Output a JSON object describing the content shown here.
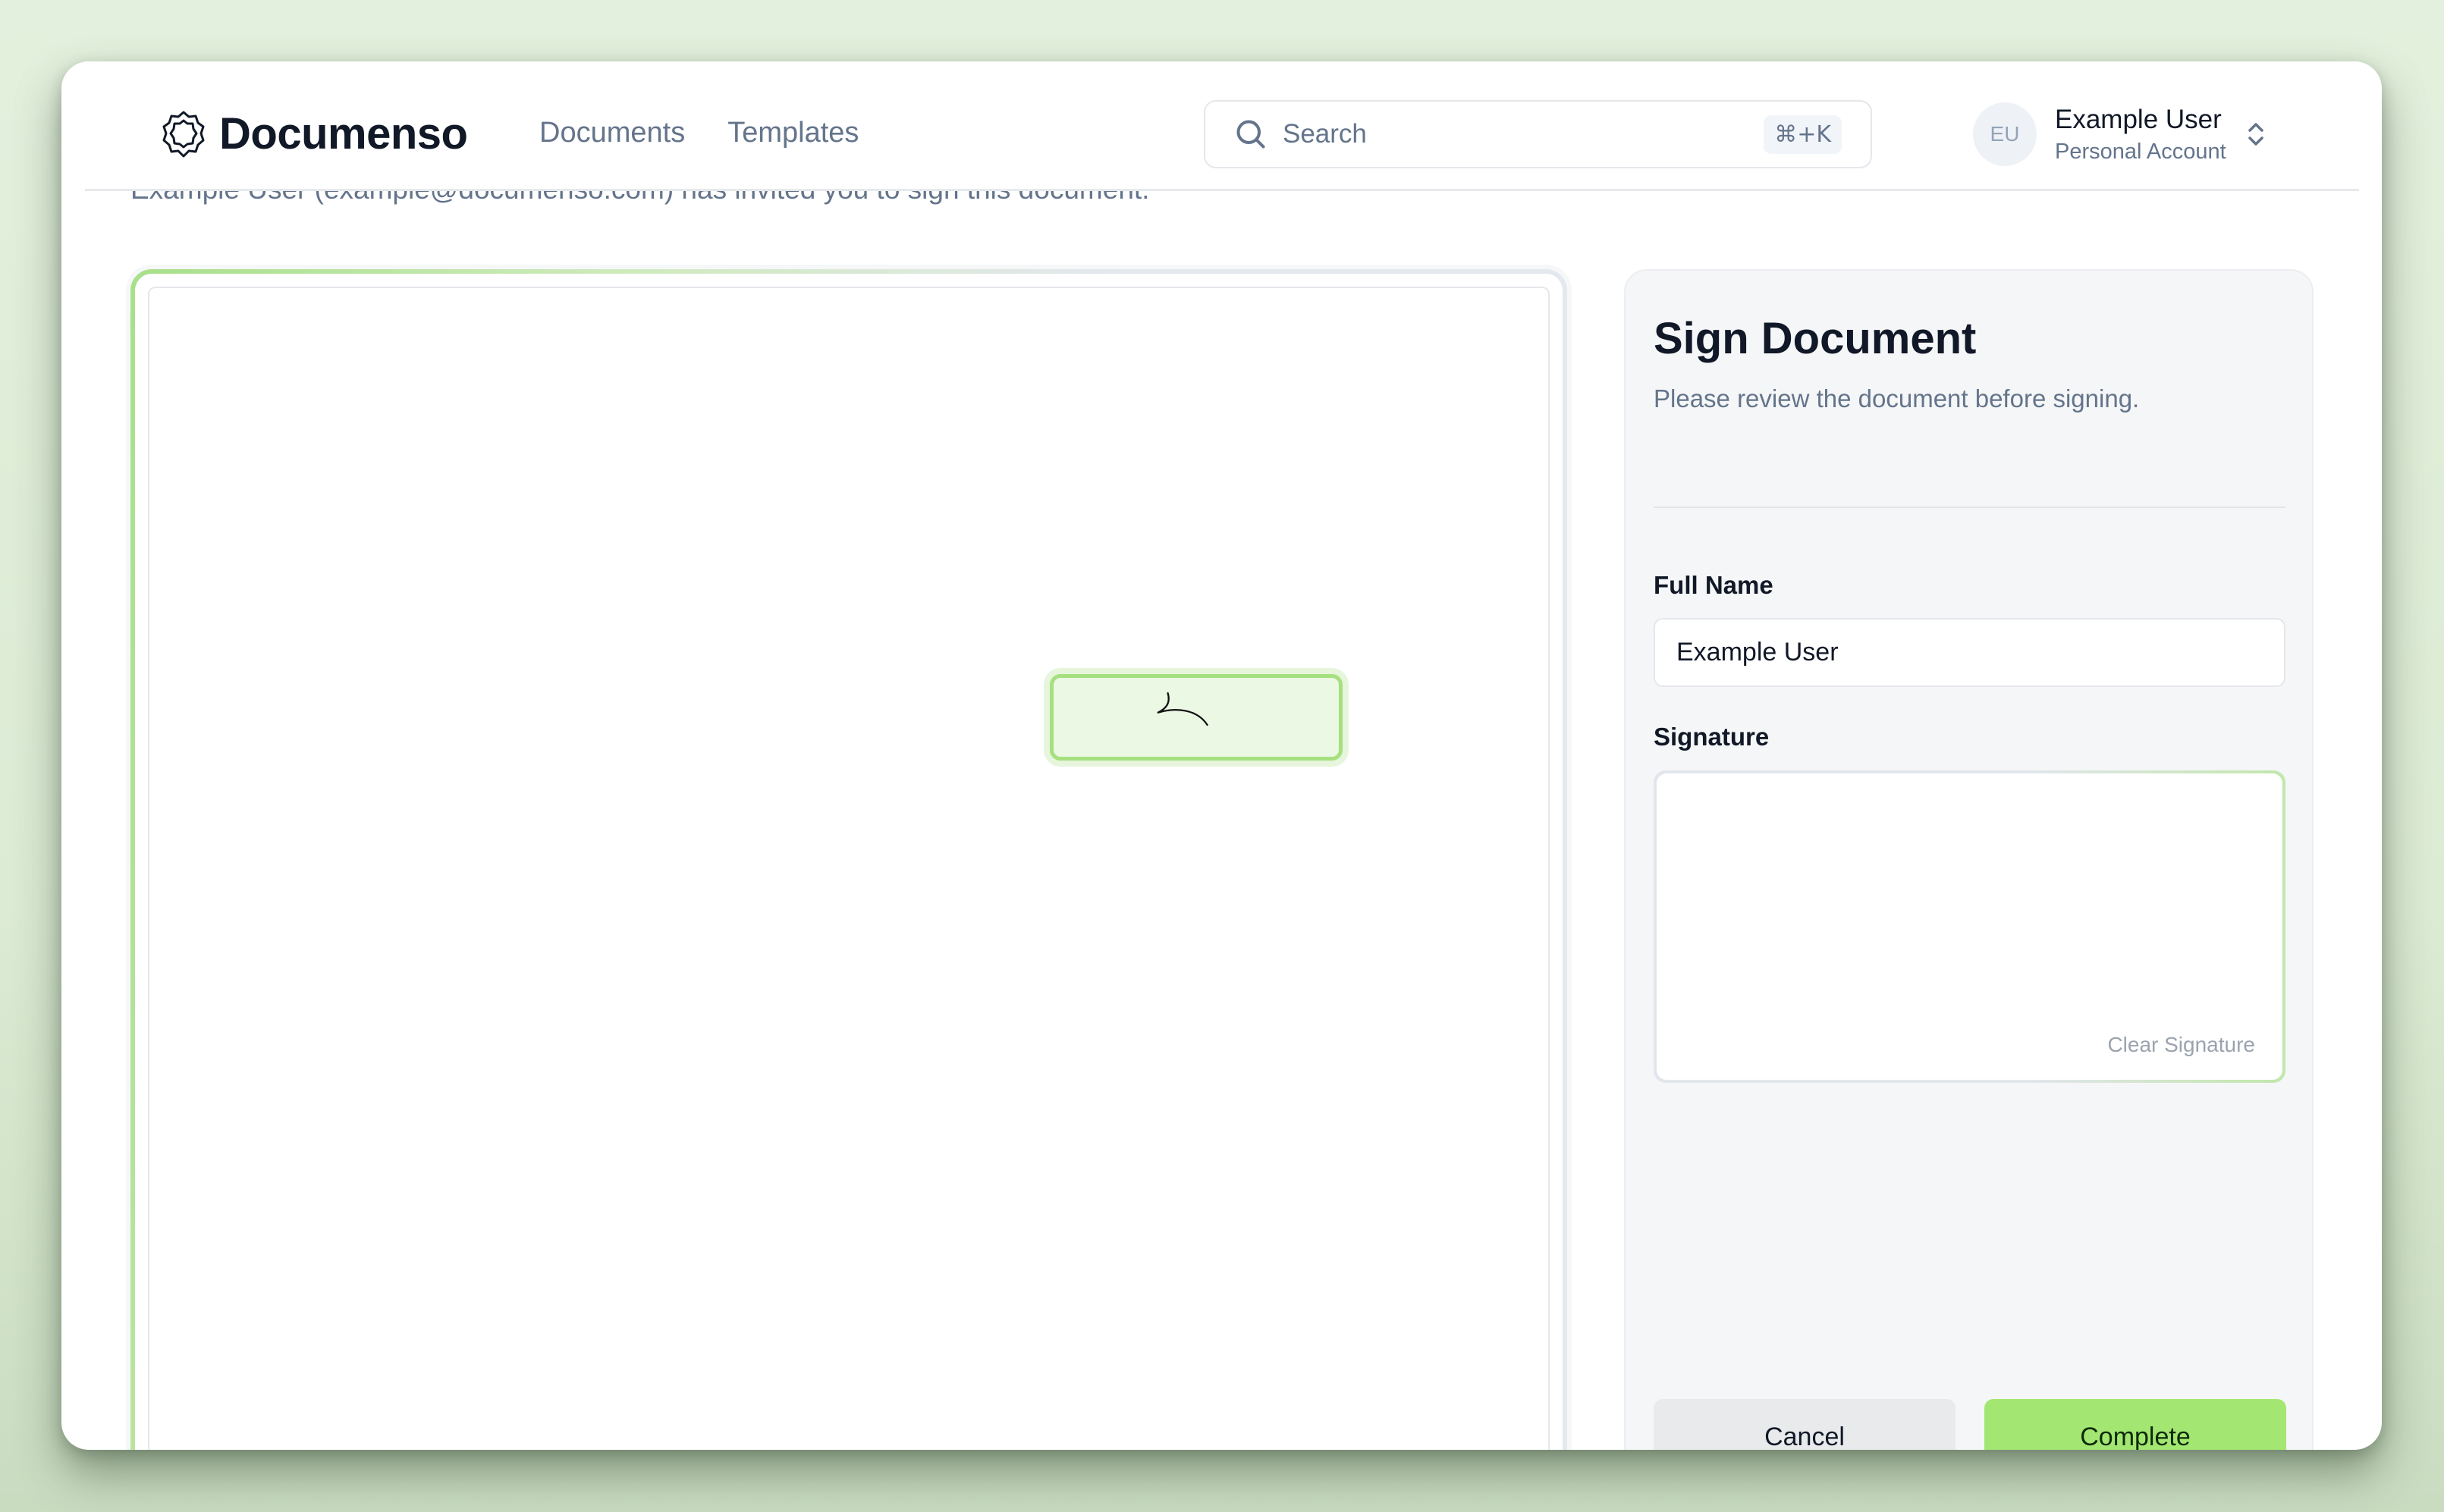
{
  "app": {
    "brand": "Documenso",
    "nav": [
      {
        "label": "Documents"
      },
      {
        "label": "Templates"
      }
    ],
    "search": {
      "placeholder": "Search",
      "shortcut": "⌘+K"
    },
    "account": {
      "initials": "EU",
      "name": "Example User",
      "type": "Personal Account"
    }
  },
  "page": {
    "invite_text": "Example User (example@documenso.com) has invited you to sign this document."
  },
  "sign_panel": {
    "title": "Sign Document",
    "subtitle": "Please review the document before signing.",
    "full_name_label": "Full Name",
    "full_name_value": "Example User",
    "signature_label": "Signature",
    "clear_signature": "Clear Signature",
    "cancel_label": "Cancel",
    "complete_label": "Complete"
  },
  "colors": {
    "accent": "#a3e772",
    "field_bg": "#ebf8e3",
    "field_border": "#a6e07f"
  }
}
